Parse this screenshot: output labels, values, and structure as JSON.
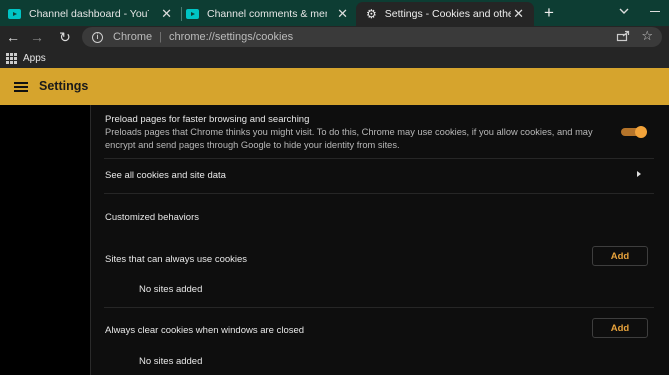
{
  "tabs": [
    {
      "title": "Channel dashboard - YouTube",
      "icon": "youtube-icon"
    },
    {
      "title": "Channel comments & mentions",
      "icon": "youtube-icon"
    },
    {
      "title": "Settings - Cookies and other site data",
      "icon": "gear-icon",
      "active": true
    }
  ],
  "toolbar": {
    "omnibox_scheme": "Chrome",
    "omnibox_separator": "|",
    "omnibox_url": "chrome://settings/cookies"
  },
  "bookmarks": {
    "apps_label": "Apps"
  },
  "header": {
    "title": "Settings"
  },
  "content": {
    "preload": {
      "title": "Preload pages for faster browsing and searching",
      "description": "Preloads pages that Chrome thinks you might visit. To do this, Chrome may use cookies, if you allow cookies, and may encrypt and send pages through Google to hide your identity from sites.",
      "enabled": true
    },
    "see_all": "See all cookies and site data",
    "customized_heading": "Customized behaviors",
    "always_allow": {
      "label": "Sites that can always use cookies",
      "add_label": "Add",
      "empty": "No sites added"
    },
    "always_clear": {
      "label": "Always clear cookies when windows are closed",
      "add_label": "Add",
      "empty": "No sites added"
    }
  },
  "colors": {
    "accent": "#d6a42d",
    "toggle_on": "#f2a33a",
    "tabstrip": "#0d3d33"
  }
}
